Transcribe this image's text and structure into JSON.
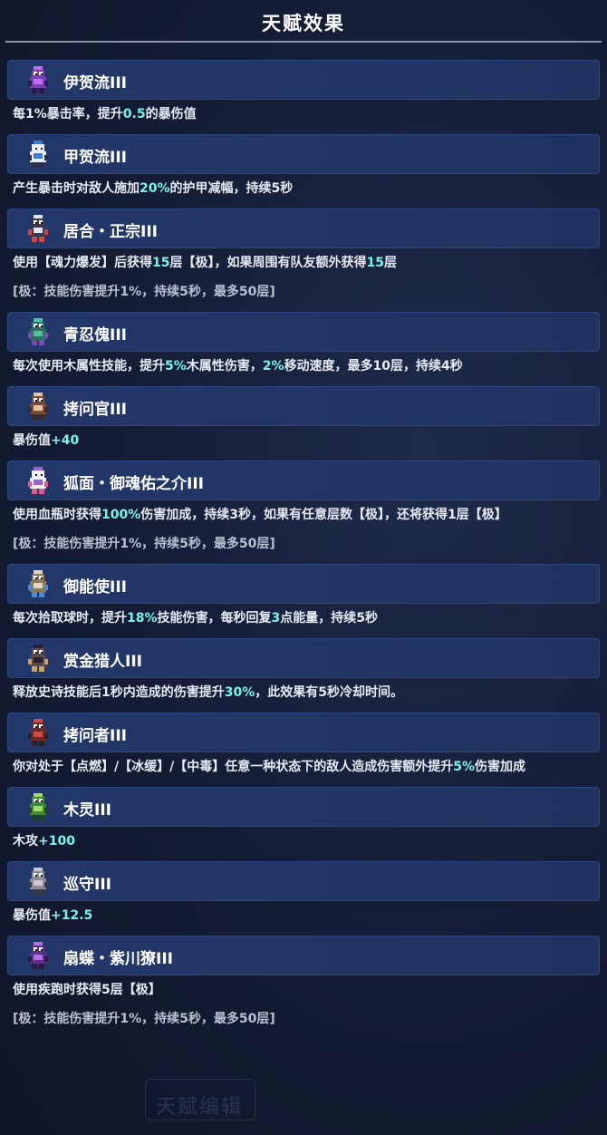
{
  "title": "天赋效果",
  "background_hint": "天赋编辑",
  "colors": {
    "highlight": "#7ef2e6",
    "header_bg": "#23386a",
    "divider": "#8a93a8"
  },
  "talents": [
    {
      "name": "伊贺流III",
      "icon": "purple-ninja-icon",
      "desc": [
        [
          "t",
          "每1%暴击率，提升"
        ],
        [
          "h",
          "0.5"
        ],
        [
          "t",
          "的暴伤值"
        ]
      ],
      "extra": ""
    },
    {
      "name": "甲贺流III",
      "icon": "white-ninja-icon",
      "desc": [
        [
          "t",
          "产生暴击时对敌人施加"
        ],
        [
          "h",
          "20%"
        ],
        [
          "t",
          "的护甲减幅，持续5秒"
        ]
      ],
      "extra": ""
    },
    {
      "name": "居合・正宗III",
      "icon": "samurai-icon",
      "desc": [
        [
          "t",
          "使用【魂力爆发】后获得"
        ],
        [
          "h",
          "15"
        ],
        [
          "t",
          "层【极】，如果周围有队友额外获得"
        ],
        [
          "h",
          "15"
        ],
        [
          "t",
          "层"
        ]
      ],
      "extra": "[极：技能伤害提升1%，持续5秒，最多50层]"
    },
    {
      "name": "青忍傀III",
      "icon": "green-puppet-icon",
      "desc": [
        [
          "t",
          "每次使用木属性技能，提升"
        ],
        [
          "h",
          "5%"
        ],
        [
          "t",
          "木属性伤害，"
        ],
        [
          "h",
          "2%"
        ],
        [
          "t",
          "移动速度，最多10层，持续4秒"
        ]
      ],
      "extra": ""
    },
    {
      "name": "拷问官III",
      "icon": "interrogator-icon",
      "desc": [
        [
          "t",
          "暴伤值"
        ],
        [
          "h",
          "+40"
        ]
      ],
      "extra": ""
    },
    {
      "name": "狐面・御魂佑之介III",
      "icon": "fox-mask-icon",
      "desc": [
        [
          "t",
          "使用血瓶时获得"
        ],
        [
          "h",
          "100%"
        ],
        [
          "t",
          "伤害加成，持续3秒，如果有任意层数【极】，还将获得1层【极】"
        ]
      ],
      "extra": "[极：技能伤害提升1%，持续5秒，最多50层]"
    },
    {
      "name": "御能使III",
      "icon": "energy-master-icon",
      "desc": [
        [
          "t",
          "每次拾取球时，提升"
        ],
        [
          "h",
          "18%"
        ],
        [
          "t",
          "技能伤害，每秒回复"
        ],
        [
          "h",
          "3"
        ],
        [
          "t",
          "点能量，持续5秒"
        ]
      ],
      "extra": ""
    },
    {
      "name": "赏金猎人III",
      "icon": "bounty-hunter-icon",
      "desc": [
        [
          "t",
          "释放史诗技能后1秒内造成的伤害提升"
        ],
        [
          "h",
          "30%"
        ],
        [
          "t",
          "，此效果有5秒冷却时间。"
        ]
      ],
      "extra": ""
    },
    {
      "name": "拷问者III",
      "icon": "torturer-icon",
      "desc": [
        [
          "t",
          "你对处于【点燃】/【冰缓】/【中毒】任意一种状态下的敌人造成伤害额外提升"
        ],
        [
          "h",
          "5%"
        ],
        [
          "t",
          "伤害加成"
        ]
      ],
      "extra": ""
    },
    {
      "name": "木灵III",
      "icon": "wood-spirit-icon",
      "desc": [
        [
          "t",
          "木攻"
        ],
        [
          "h",
          "+100"
        ]
      ],
      "extra": ""
    },
    {
      "name": "巡守III",
      "icon": "guard-icon",
      "desc": [
        [
          "t",
          "暴伤值"
        ],
        [
          "h",
          "+12.5"
        ]
      ],
      "extra": ""
    },
    {
      "name": "扇蝶・紫川獠III",
      "icon": "butterfly-ninja-icon",
      "desc": [
        [
          "t",
          "使用疾跑时获得5层【极】"
        ]
      ],
      "extra": "[极：技能伤害提升1%，持续5秒，最多50层]"
    }
  ]
}
